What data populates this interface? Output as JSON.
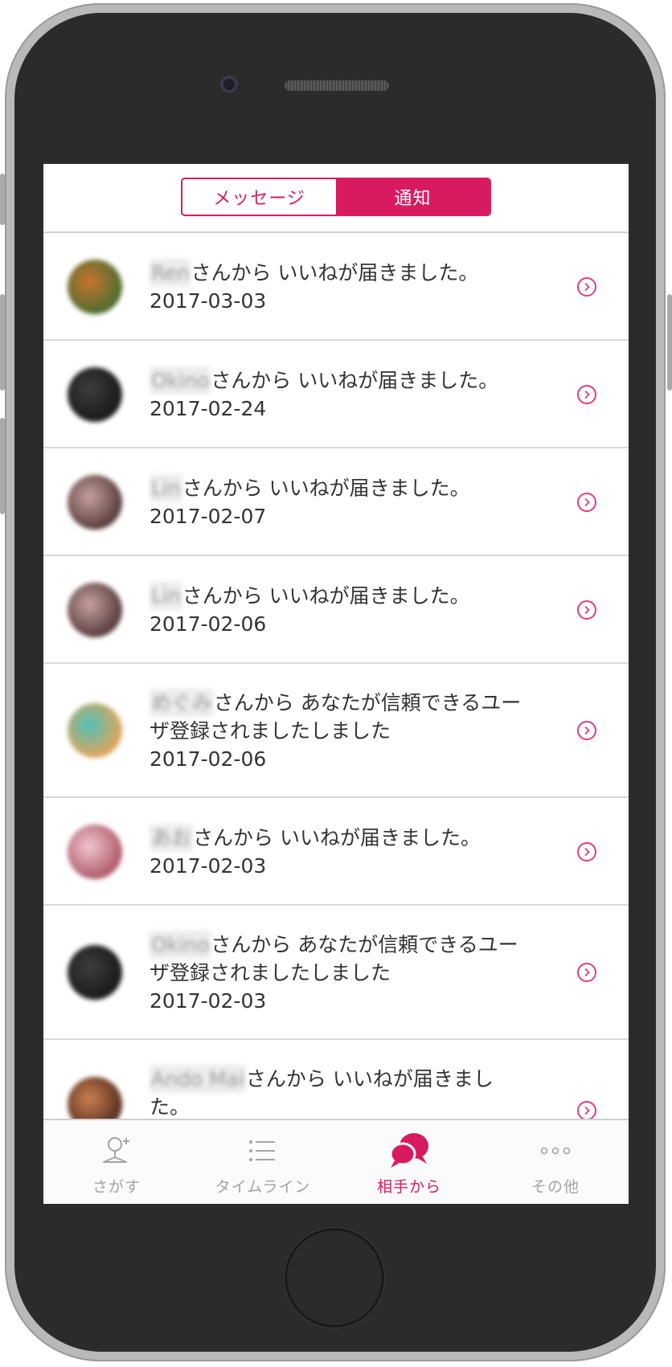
{
  "segment": {
    "items": [
      {
        "label": "メッセージ",
        "active": false
      },
      {
        "label": "通知",
        "active": true
      }
    ],
    "accent": "#d81b60"
  },
  "notifications": [
    {
      "name": "Ren",
      "text": "さんから いいねが届きました。",
      "date": "2017-03-03",
      "avatar": [
        "#4e6e2f",
        "#c9742f"
      ]
    },
    {
      "name": "Okino",
      "text": "さんから いいねが届きました。",
      "date": "2017-02-24",
      "avatar": [
        "#1a1a1a",
        "#3d3d3d"
      ]
    },
    {
      "name": "Lin",
      "text": "さんから いいねが届きました。",
      "date": "2017-02-07",
      "avatar": [
        "#5a3c3c",
        "#c7a2a2"
      ]
    },
    {
      "name": "Lin",
      "text": "さんから いいねが届きました。",
      "date": "2017-02-06",
      "avatar": [
        "#5a3c3c",
        "#c7a2a2"
      ]
    },
    {
      "name": "めぐみ",
      "text": "さんから あなたが信頼できるユーザ登録されましたしました",
      "date": "2017-02-06",
      "avatar": [
        "#e0a55a",
        "#4fc0b8"
      ]
    },
    {
      "name": "あお",
      "text": "さんから いいねが届きました。",
      "date": "2017-02-03",
      "avatar": [
        "#b05a6a",
        "#f0c8d0"
      ]
    },
    {
      "name": "Okino",
      "text": "さんから あなたが信頼できるユーザ登録されましたしました",
      "date": "2017-02-03",
      "avatar": [
        "#1a1a1a",
        "#3d3d3d"
      ]
    },
    {
      "name": "Ando Mai",
      "text": "さんから いいねが届きました。",
      "date": "",
      "avatar": [
        "#5a3020",
        "#c98050"
      ]
    }
  ],
  "tabbar": {
    "items": [
      {
        "label": "さがす",
        "icon": "person-add-icon",
        "active": false
      },
      {
        "label": "タイムライン",
        "icon": "list-icon",
        "active": false
      },
      {
        "label": "相手から",
        "icon": "chat-bubbles-icon",
        "active": true
      },
      {
        "label": "その他",
        "icon": "more-dots-icon",
        "active": false
      }
    ]
  }
}
